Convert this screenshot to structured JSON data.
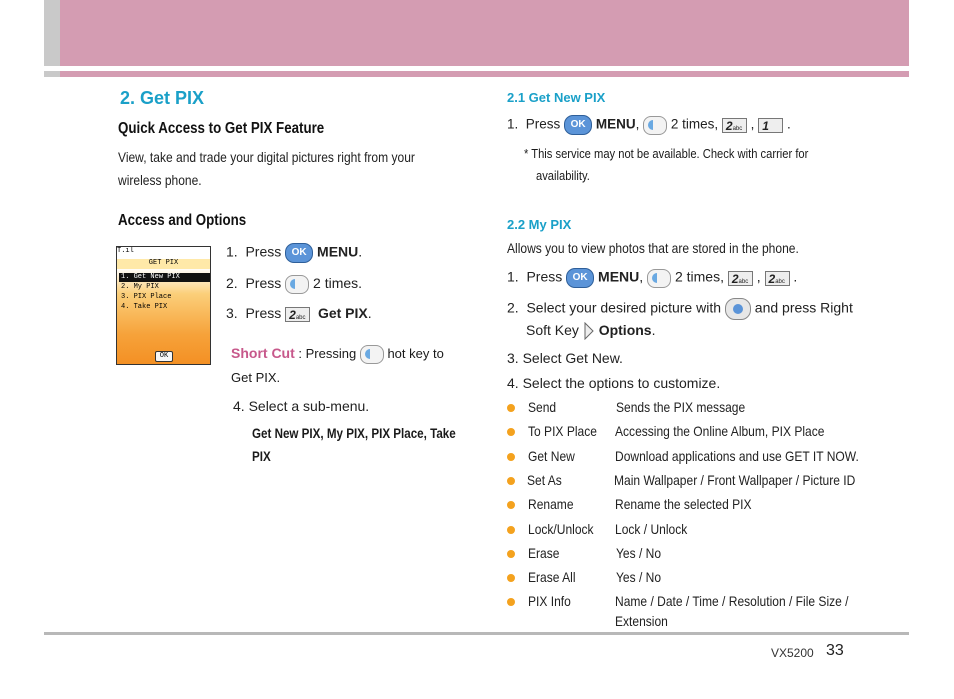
{
  "section_title": "2. Get PIX",
  "quick": {
    "heading": "Quick Access to Get PIX  Feature",
    "desc_line1": "View, take and trade your digital pictures right from your",
    "desc_line2": "wireless phone."
  },
  "access": {
    "heading": "Access and Options",
    "step1_num": "1.",
    "step1_press": "Press",
    "step1_menu": "MENU",
    "step1_dot": ".",
    "step2_num": "2.",
    "step2_press": "Press",
    "step2_times": "2 times.",
    "step3_num": "3.",
    "step3_press": "Press",
    "step3_label": "Get PIX",
    "step3_dot": ".",
    "shortcut_label": "Short Cut",
    "shortcut_text1": ": Pressing",
    "shortcut_text2": "hot key to",
    "shortcut_text3": "Get PIX.",
    "step4": "4.  Select a sub-menu.",
    "submenu_line1": "Get New PIX, My PIX, PIX Place, Take",
    "submenu_line2": "PIX"
  },
  "phone_screen": {
    "status": "T.ıl",
    "title": "GET PIX",
    "items": [
      "1. Get New PIX",
      "2. My PIX",
      "3. PIX Place",
      "4. Take PIX"
    ],
    "ok": "OK"
  },
  "getnew": {
    "heading": "2.1 Get New PIX",
    "step_num": "1.",
    "press": "Press",
    "menu": "MENU",
    "comma": ",",
    "times": "2 times,",
    "comma2": ",",
    "end": ".",
    "note1": "*  This service may not be available. Check with carrier for",
    "note2": "availability."
  },
  "mypix": {
    "heading": "2.2 My PIX",
    "desc": "Allows you to view photos that are stored in the phone.",
    "s1_num": "1.",
    "s1_press": "Press",
    "s1_menu": "MENU",
    "s1_comma": ",",
    "s1_times": "2 times,",
    "s1_comma2": ",",
    "s1_end": ".",
    "s2_num": "2.",
    "s2_a": "Select your desired picture with",
    "s2_b": "and press Right",
    "s2_c": "Soft Key",
    "s2_options": "Options",
    "s2_end": ".",
    "s3": "3.  Select Get New.",
    "s4": "4.  Select the options to customize.",
    "options": [
      {
        "name": "Send",
        "desc": "Sends the PIX message"
      },
      {
        "name": "To PIX Place",
        "desc": "Accessing the Online Album, PIX Place"
      },
      {
        "name": "Get New",
        "desc": "Download applications and use GET IT NOW."
      },
      {
        "name": "Set As",
        "desc": "Main Wallpaper / Front Wallpaper / Picture ID"
      },
      {
        "name": "Rename",
        "desc": "Rename the selected PIX"
      },
      {
        "name": "Lock/Unlock",
        "desc": "Lock / Unlock"
      },
      {
        "name": "Erase",
        "desc": "Yes / No"
      },
      {
        "name": "Erase All",
        "desc": "Yes / No"
      },
      {
        "name": "PIX Info",
        "desc": "Name / Date / Time / Resolution / File Size /",
        "desc2": "Extension"
      }
    ]
  },
  "keys": {
    "ok": "OK",
    "two": "2",
    "two_sub": "abc",
    "one": "1"
  },
  "footer": {
    "model": "VX5200",
    "page": "33"
  },
  "colors": {
    "header_pink": "#d49cb2",
    "header_gray": "#c9c9c9",
    "heading_cyan": "#1aa0c8",
    "shortcut_pink": "#c7588b",
    "bullet_orange": "#f4a21e"
  }
}
